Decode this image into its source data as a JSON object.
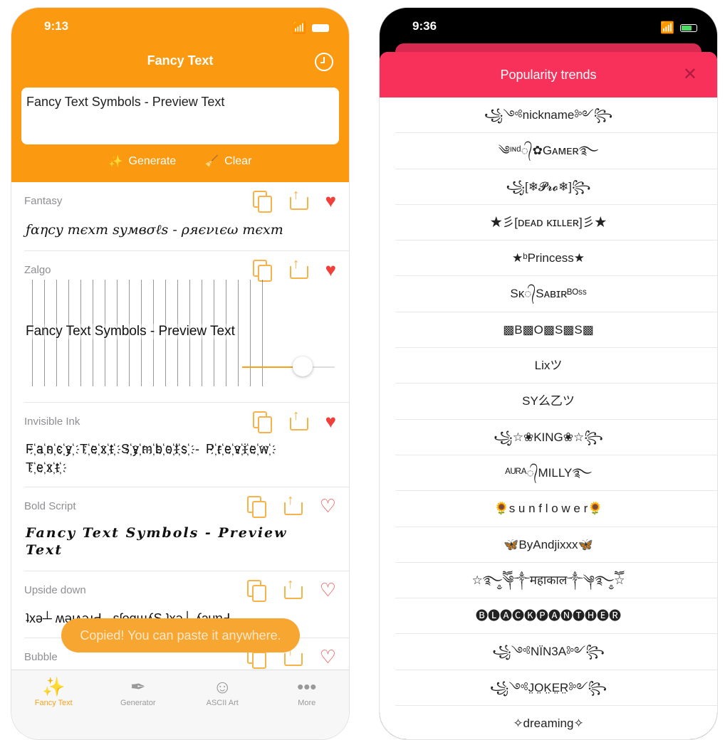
{
  "left": {
    "status_time": "9:13",
    "title": "Fancy Text",
    "input_value": "Fancy Text Symbols - Preview Text",
    "generate_label": "Generate",
    "clear_label": "Clear",
    "styles": [
      {
        "label": "Fantasy",
        "text": "ƒαηcy тєxт ѕумвσℓѕ - ρяєνιєω тєxт",
        "favorite": true
      },
      {
        "label": "Zalgo",
        "text": "Fancy Text Symbols - Preview Text",
        "favorite": true,
        "intensity": 0.65
      },
      {
        "label": "Invisible Ink",
        "text": "F҉a҉n҉c҉y҉ T҉e҉x҉t҉ S҉y҉m҉b҉o҉l҉s҉ - P҉r҉e҉v҉i҉e҉w҉ T҉e҉x҉t҉",
        "favorite": true
      },
      {
        "label": "Bold Script",
        "text": "Fancy Text Symbols - Preview Text",
        "favorite": false
      },
      {
        "label": "Upside down",
        "text": "ʇxǝ┴ ʍǝıʌǝɹԀ - sʃoqɯʎS ʇxǝ┴ ʎɔuɐℲ",
        "favorite": false
      },
      {
        "label": "Bubble",
        "text": "",
        "favorite": false
      }
    ],
    "toast": "Copied! You can paste it anywhere.",
    "tabs": [
      {
        "label": "Fancy Text",
        "icon": "magic-wand-icon",
        "active": true
      },
      {
        "label": "Generator",
        "icon": "feather-icon",
        "active": false
      },
      {
        "label": "ASCII Art",
        "icon": "smiley-icon",
        "active": false
      },
      {
        "label": "More",
        "icon": "more-icon",
        "active": false
      }
    ],
    "accent": "#fb9a10"
  },
  "right": {
    "status_time": "9:36",
    "sheet_title": "Popularity trends",
    "accent": "#f7315a",
    "trends": [
      "꧁༺nickname༻꧂",
      "༄ᶦᶰᵈ᭄✿Gᴀᴍᴇʀ࿐",
      "꧁[❄𝓟𝓻𝓸❄]꧂",
      "★彡[ᴅᴇᴀᴅ ᴋɪʟʟᴇʀ]彡★",
      "★ᵇPrincess★",
      "Sᴋ᭄Sᴀʙɪʀᴮᴼˢˢ",
      "▩B▩O▩S▩S▩",
      "Lixツ",
      "SY么乙ツ",
      "꧁☆❀KING❀☆꧂",
      "ᴬᵁᴿᴬ᭄MILLY࿐",
      "🌻s u n f l o w e r🌻",
      "🦋ByAndjixxx🦋",
      "☆࿐ཽ༵༆༒महाकाल༒༆࿐ཽ༵☆",
      "🅑🅛🅐🅒🅚🅟🅐🅝🅣🅗🅔🅡",
      "꧁༺NÏN3A༻꧂",
      "꧁༺J̤O̤K̤E̤R̤༻꧂",
      "✧dreaming✧"
    ]
  }
}
